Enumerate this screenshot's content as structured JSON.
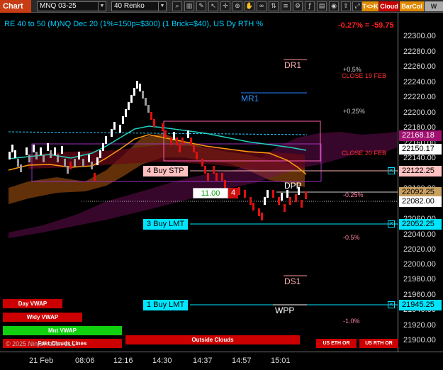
{
  "toolbar": {
    "title": "Chart",
    "instrument": "MNQ 03-25",
    "bar_type": "40 Renko",
    "btn_tk": "T<>K",
    "btn_cloud": "Cloud",
    "btn_barcol": "BarCol",
    "btn_w": "W VVV"
  },
  "chart": {
    "header": "RE 40 to 50 (M)NQ Dec 20 (1%=150p=$300) (1 Brick=$40), US Dy RTH %",
    "change": "-0.27% = -59.75"
  },
  "levels": {
    "dr1": "DR1",
    "mr1": "MR1",
    "dpp": "DPP",
    "ds1": "DS1",
    "wpp": "WPP",
    "pct_p05": "+0.5%",
    "close_19feb": "CLOSE 19 FEB",
    "pct_p025": "+0.25%",
    "close_20feb": "CLOSE 20 FEB",
    "pct_m025": "-0.25%",
    "pct_m05": "-0.5%",
    "pct_m10": "-1.0%"
  },
  "orders": {
    "buy_stp": "4 Buy STP",
    "buy_lmt_1": "3 Buy LMT",
    "buy_lmt_2": "1 Buy LMT",
    "position_price": "11.00",
    "position_qty": "4"
  },
  "price_axis": {
    "ticks": [
      "22300.00",
      "22280.00",
      "22260.00",
      "22240.00",
      "22220.00",
      "22200.00",
      "22180.00",
      "22160.00",
      "22140.00",
      "22120.00",
      "22100.00",
      "22080.00",
      "22060.00",
      "22040.00",
      "22020.00",
      "22000.00",
      "21980.00",
      "21960.00",
      "21940.00",
      "21920.00",
      "21900.00"
    ],
    "tag_1": "22168.18",
    "tag_2": "22150.17",
    "tag_3": "22122.25",
    "tag_4": "22092.25",
    "tag_5": "22082.00",
    "tag_6": "22052.25",
    "tag_7": "21945.25"
  },
  "bottom_buttons": {
    "day_vwap": "Day VWAP",
    "wkly_vwap": "Wkly VWAP",
    "mnt_vwap": "Mnt VWAP",
    "fast_clouds": "Fast Clouds Lines",
    "outside_clouds": "Outside Clouds",
    "us_eth_or": "US ETH OR",
    "us_rth_or": "US RTH OR"
  },
  "copyright": "© 2025 NinjaTrader, LLC",
  "time_axis": [
    "21 Feb",
    "08:06",
    "12:16",
    "14:30",
    "14:37",
    "14:57",
    "15:01"
  ],
  "colors": {
    "toolbar_red": "#c83c14",
    "cloud_red": "#cc0000",
    "barcol_orange": "#e08a00",
    "cyan": "#00e5ff",
    "up_brick": "#ffffff",
    "down_brick": "#e01010"
  }
}
